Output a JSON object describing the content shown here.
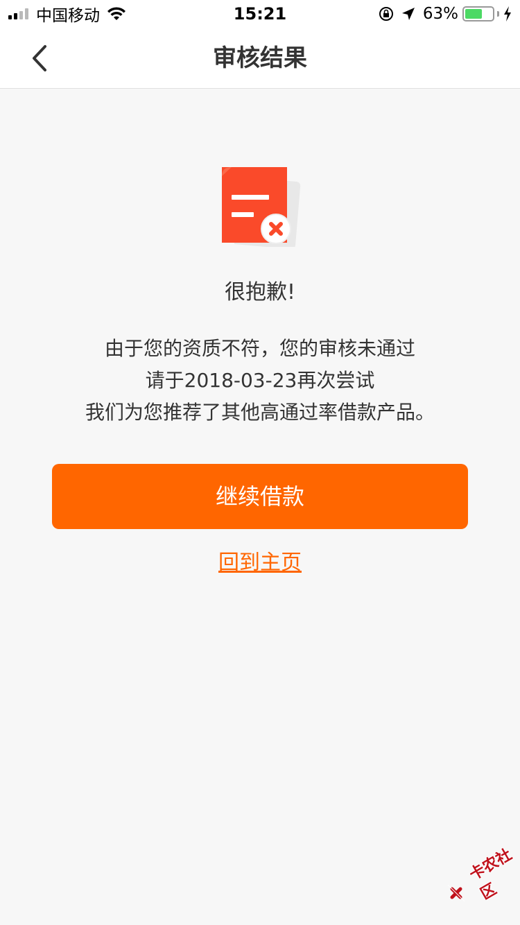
{
  "status_bar": {
    "carrier": "中国移动",
    "time": "15:21",
    "battery_percent": "63%",
    "battery_level": 0.63,
    "icons": [
      "signal-icon",
      "wifi-icon",
      "orientation-lock-icon",
      "location-arrow-icon",
      "battery-icon",
      "charging-bolt-icon"
    ]
  },
  "nav": {
    "title": "审核结果",
    "back_icon": "chevron-left-icon"
  },
  "result": {
    "icon": "document-rejected-icon",
    "headline": "很抱歉!",
    "lines": [
      "由于您的资质不符，您的审核未通过",
      "请于2018-03-23再次尝试",
      "我们为您推荐了其他高通过率借款产品。"
    ]
  },
  "actions": {
    "continue_label": "继续借款",
    "home_label": "回到主页"
  },
  "watermark": {
    "text": "卡农社区"
  },
  "colors": {
    "accent": "#ff6600",
    "background": "#f7f7f7",
    "icon_red": "#fa4a2a",
    "battery_green": "#4cd964"
  }
}
